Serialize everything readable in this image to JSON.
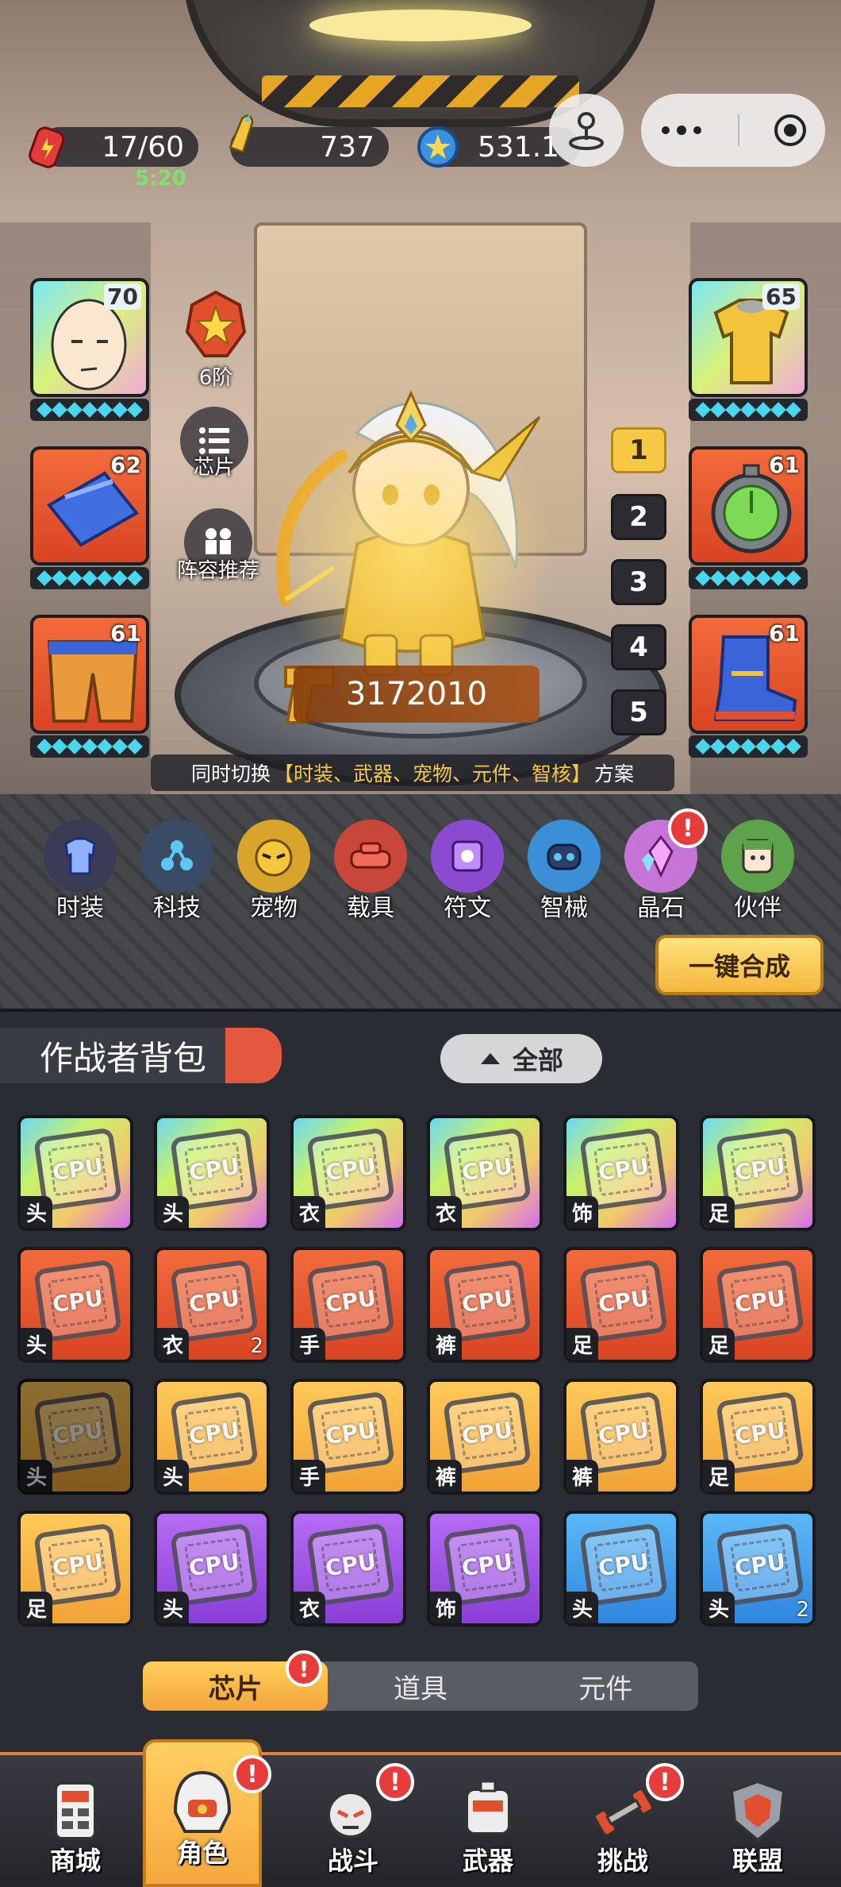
{
  "hud": {
    "energy": "17/60",
    "energy_timer": "5:20",
    "ammo": "737",
    "coins": "531.1"
  },
  "hero": {
    "power": "3172010",
    "rank_badge": "6阶",
    "skin_level": "70"
  },
  "equipment": {
    "left": [
      {
        "name": "blue-gloves",
        "level": "62"
      },
      {
        "name": "orange-pants",
        "level": "61"
      }
    ],
    "right": [
      {
        "name": "yellow-shirt",
        "level": "65"
      },
      {
        "name": "radar-watch",
        "level": "61"
      },
      {
        "name": "blue-boots",
        "level": "61"
      }
    ]
  },
  "side_buttons": {
    "chip": "芯片",
    "lineup": "阵容推荐"
  },
  "presets": [
    "1",
    "2",
    "3",
    "4",
    "5"
  ],
  "switch_notice": {
    "prefix": "同时切换",
    "highlight": "【时装、武器、宠物、元件、智核】",
    "suffix": "方案"
  },
  "functions": [
    {
      "label": "时装",
      "icon": "costume-icon",
      "color": "#3a3b55"
    },
    {
      "label": "科技",
      "icon": "tech-icon",
      "color": "#3a4b66"
    },
    {
      "label": "宠物",
      "icon": "pet-icon",
      "color": "#d9a42c"
    },
    {
      "label": "载具",
      "icon": "vehicle-icon",
      "color": "#c9463a"
    },
    {
      "label": "符文",
      "icon": "rune-icon",
      "color": "#8b4bd1"
    },
    {
      "label": "智械",
      "icon": "robot-icon",
      "color": "#3b8fd6"
    },
    {
      "label": "晶石",
      "icon": "crystal-icon",
      "color": "#c774d8",
      "badge": "!"
    },
    {
      "label": "伙伴",
      "icon": "partner-icon",
      "color": "#5fa24c"
    }
  ],
  "merge_button": "一键合成",
  "bag": {
    "title": "作战者背包",
    "filter": "全部",
    "items": [
      {
        "slot": "头",
        "count": "",
        "rarity": "rainbow"
      },
      {
        "slot": "头",
        "count": "",
        "rarity": "rainbow"
      },
      {
        "slot": "衣",
        "count": "",
        "rarity": "rainbow"
      },
      {
        "slot": "衣",
        "count": "",
        "rarity": "rainbow"
      },
      {
        "slot": "饰",
        "count": "",
        "rarity": "rainbow"
      },
      {
        "slot": "足",
        "count": "",
        "rarity": "rainbow"
      },
      {
        "slot": "头",
        "count": "",
        "rarity": "red"
      },
      {
        "slot": "衣",
        "count": "2",
        "rarity": "red"
      },
      {
        "slot": "手",
        "count": "",
        "rarity": "red"
      },
      {
        "slot": "裤",
        "count": "",
        "rarity": "red"
      },
      {
        "slot": "足",
        "count": "",
        "rarity": "red"
      },
      {
        "slot": "足",
        "count": "",
        "rarity": "red"
      },
      {
        "slot": "头",
        "count": "",
        "rarity": "gold-dim"
      },
      {
        "slot": "头",
        "count": "",
        "rarity": "gold"
      },
      {
        "slot": "手",
        "count": "",
        "rarity": "gold"
      },
      {
        "slot": "裤",
        "count": "",
        "rarity": "gold"
      },
      {
        "slot": "裤",
        "count": "",
        "rarity": "gold"
      },
      {
        "slot": "足",
        "count": "",
        "rarity": "gold"
      },
      {
        "slot": "足",
        "count": "",
        "rarity": "gold"
      },
      {
        "slot": "头",
        "count": "",
        "rarity": "purple"
      },
      {
        "slot": "衣",
        "count": "",
        "rarity": "purple"
      },
      {
        "slot": "饰",
        "count": "",
        "rarity": "purple"
      },
      {
        "slot": "头",
        "count": "",
        "rarity": "blue"
      },
      {
        "slot": "头",
        "count": "2",
        "rarity": "blue"
      }
    ],
    "chip_text": "CPU",
    "tabs": [
      {
        "label": "芯片",
        "active": true,
        "badge": "!"
      },
      {
        "label": "道具",
        "active": false
      },
      {
        "label": "元件",
        "active": false
      }
    ]
  },
  "nav": [
    {
      "label": "商城",
      "icon": "shop-icon",
      "active": false,
      "badge": ""
    },
    {
      "label": "角色",
      "icon": "character-icon",
      "active": true,
      "badge": "!"
    },
    {
      "label": "战斗",
      "icon": "battle-icon",
      "active": false,
      "badge": "!"
    },
    {
      "label": "武器",
      "icon": "weapon-icon",
      "active": false,
      "badge": ""
    },
    {
      "label": "挑战",
      "icon": "challenge-icon",
      "active": false,
      "badge": "!"
    },
    {
      "label": "联盟",
      "icon": "alliance-icon",
      "active": false,
      "badge": ""
    }
  ],
  "colors": {
    "rainbow": "linear-gradient(135deg,#6bd7f2,#c7f26b,#f2c76b,#d46bf2)",
    "red": "linear-gradient(180deg,#f26b3c,#d84423)",
    "gold": "linear-gradient(180deg,#ffc95a,#f0a235)",
    "gold-dim": "linear-gradient(180deg,#b07a2a,#7c5416)",
    "purple": "linear-gradient(180deg,#b56bf2,#8a3ed8)",
    "blue": "linear-gradient(180deg,#5bb8f5,#2f86e0)"
  }
}
